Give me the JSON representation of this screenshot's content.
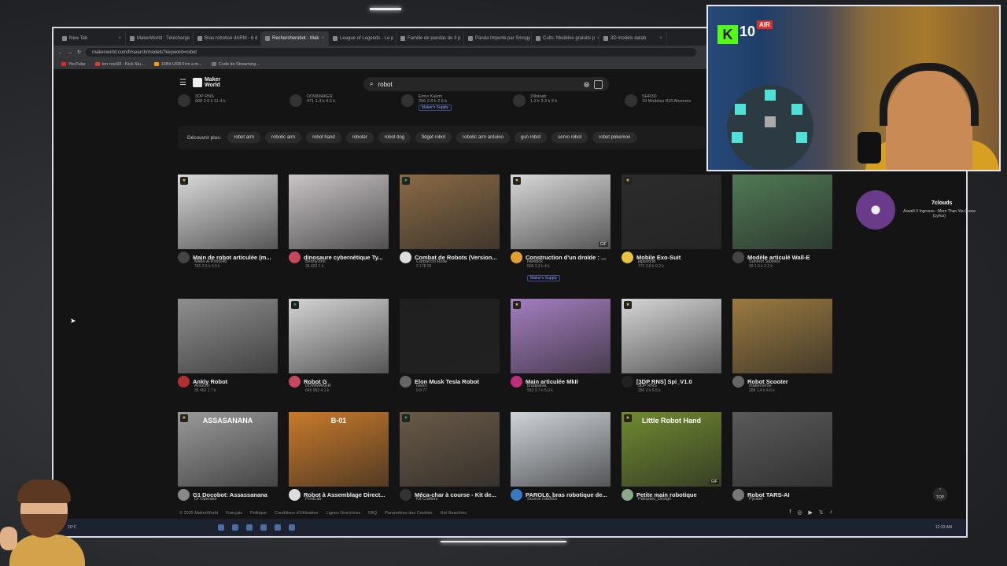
{
  "browser": {
    "tabs": [
      {
        "label": "New Tab",
        "active": false
      },
      {
        "label": "MakerWorld : Télécharge",
        "active": false
      },
      {
        "label": "Bras robotisé dARM - 6 d",
        "active": false
      },
      {
        "label": "Rechercherobot - Mak",
        "active": true
      },
      {
        "label": "League of Legends - Le p",
        "active": false
      },
      {
        "label": "Famille de pandas de 3 p",
        "active": false
      },
      {
        "label": "Panda Importé par Smogy",
        "active": false
      },
      {
        "label": "Cults: Modèles gratuits p",
        "active": false
      },
      {
        "label": "3D models datab",
        "active": false
      }
    ],
    "url": "makerworld.com/fr/search/models?keyword=robot",
    "bookmarks": [
      "YouTube",
      "ten noo93 - Kick Stu...",
      "16Bit USB Frm a m...",
      "Code de Streaming..."
    ]
  },
  "header": {
    "logo": "Maker World",
    "search_value": "robot"
  },
  "toprow": [
    {
      "author": "3DP RNS",
      "stats": "908  2.6 k  11.4 k"
    },
    {
      "author": "DDWMAKER",
      "stats": "471  1.4 k  4.5 k"
    },
    {
      "author": "Emre Kalem",
      "stats": "206  2.8 k  2.5 k",
      "supply": "Maker's Supply"
    },
    {
      "author": "Zillolaab",
      "stats": "1.2 k  3.3 k  9 k"
    },
    {
      "author": "SHR3D",
      "stats": "19 Modèles  818 Abonnés"
    }
  ],
  "discover": {
    "label": "Découvrir plus:",
    "chips": [
      "robot arm",
      "robotic arm",
      "robot hand",
      "roboter",
      "robot dog",
      "fidget robot",
      "robotic arm arduino",
      "gun robot",
      "servo robot",
      "robot pokemon"
    ]
  },
  "cards": [
    {
      "title": "Main de robot articulée (m...",
      "author": "Make-A-Print246",
      "stats": "740  2.5 k  4.5 k",
      "badge": "gold",
      "gif": false,
      "supply": "",
      "color": "#d9d9d9",
      "avatar": "#444"
    },
    {
      "title": "dinosaure cybernétique Ty...",
      "author": "BennyJinn",
      "stats": "36  433  1 k",
      "badge": "",
      "gif": false,
      "supply": "",
      "color": "#c9c4c6",
      "avatar": "#c7485a"
    },
    {
      "title": "Combat de Robots (Version...",
      "author": "Carpaccio Rude",
      "stats": "2  178  93",
      "badge": "green",
      "gif": false,
      "supply": "",
      "color": "#8a6a45",
      "avatar": "#ddd"
    },
    {
      "title": "Construction d'un droïde : ...",
      "author": "Neebick",
      "stats": "609  3.3 k  4 k",
      "badge": "gold",
      "gif": true,
      "supply": "Maker's Supply",
      "color": "#d8d8d8",
      "avatar": "#e0a030"
    },
    {
      "title": "Mobile Exo-Suit",
      "author": "jajaum3d",
      "stats": "772  3.8 k  9.2 k",
      "badge": "gold",
      "gif": false,
      "supply": "",
      "color": "#2c2c2c",
      "avatar": "#e6c340"
    },
    {
      "title": "Modèle articulé Wall-E",
      "author": "Sumeet Saxena",
      "stats": "99  1.6 k  2.2 k",
      "badge": "",
      "gif": false,
      "supply": "",
      "color": "#4f7a55",
      "avatar": "#444"
    },
    {
      "title": "Ankly Robot",
      "author": "Ariox3D",
      "stats": "35  452  1.7 k",
      "badge": "",
      "gif": false,
      "supply": "",
      "color": "#8f8f8f",
      "avatar": "#b03030"
    },
    {
      "title": "Robot G",
      "author": "DDWMAKER",
      "stats": "645  953  4.1 k",
      "badge": "green",
      "gif": false,
      "supply": "",
      "color": "#d4d4d4",
      "avatar": "#c7485a"
    },
    {
      "title": "Elon Musk Tesla Robot",
      "author": "raven",
      "stats": "9  8  77",
      "badge": "",
      "gif": false,
      "supply": "",
      "color": "#1f1f1f",
      "avatar": "#666"
    },
    {
      "title": "Main articulée MkII",
      "author": "bradpaiva",
      "stats": "553  3.7 k  5.3 k",
      "badge": "gold",
      "gif": false,
      "supply": "",
      "color": "#a57ec0",
      "avatar": "#c0307a"
    },
    {
      "title": "[3DP RNS] Spi_V1.0",
      "author": "3DP RNS",
      "stats": "350  2 k  6.5 k",
      "badge": "gold",
      "gif": false,
      "supply": "",
      "color": "#d6d6d6",
      "avatar": "#222"
    },
    {
      "title": "Robot Scooter",
      "author": "makerverse",
      "stats": "288  1.4 k  4.6 k",
      "badge": "",
      "gif": false,
      "supply": "",
      "color": "#9a7a40",
      "avatar": "#666"
    },
    {
      "title": "G1 Docobot: Assassanana",
      "author": "Dr Operator",
      "stats": "",
      "badge": "gold",
      "gif": false,
      "supply": "",
      "color": "#9a9a9a",
      "avatar": "#888",
      "overlay": "ASSASANANA"
    },
    {
      "title": "Robot à Assemblage Direct...",
      "author": "PrintLab",
      "stats": "",
      "badge": "",
      "gif": false,
      "supply": "",
      "color": "#c97a2a",
      "avatar": "#ddd",
      "overlay": "B-01"
    },
    {
      "title": "Méca-char à course - Kit de...",
      "author": "Kit Crafters",
      "stats": "",
      "badge": "green",
      "gif": false,
      "supply": "",
      "color": "#6a5a48",
      "avatar": "#333"
    },
    {
      "title": "PAROL6, bras robotique de...",
      "author": "Source robotics",
      "stats": "",
      "badge": "",
      "gif": false,
      "supply": "",
      "color": "#cfd4da",
      "avatar": "#3a7ac0"
    },
    {
      "title": "Petite main robotique",
      "author": "Patopato_Design",
      "stats": "",
      "badge": "gold",
      "gif": true,
      "supply": "",
      "color": "#6f8a30",
      "avatar": "#8a8",
      "overlay": "Little Robot Hand"
    },
    {
      "title": "Robot TARS-AI",
      "author": "Pyrater",
      "stats": "",
      "badge": "",
      "gif": false,
      "supply": "",
      "color": "#5a5a5a",
      "avatar": "#777"
    }
  ],
  "footer": {
    "copyright": "© 2025 MakerWorld",
    "lang": "Français",
    "links": [
      "Politique",
      "Conditions d'Utilisation",
      "Lignes Directrices",
      "FAQ",
      "Paramètres des Cookies",
      "Hot Searches"
    ]
  },
  "top_button": "TOP",
  "taskbar": {
    "weather": "20°C",
    "clock": "12:33 AM"
  },
  "webcam": {
    "kick": "K",
    "viewers": "10",
    "air": "AIR"
  },
  "music": {
    "artist": "7clouds",
    "track": "Axwell Λ Ingrosso - More Than You Know (Lyrics)"
  }
}
